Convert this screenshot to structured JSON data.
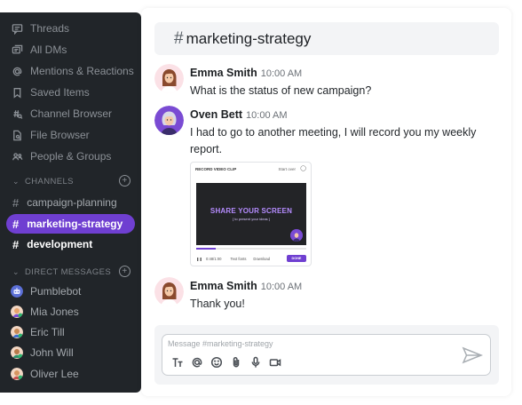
{
  "sidebar": {
    "nav": [
      {
        "label": "Threads",
        "icon": "threads-icon"
      },
      {
        "label": "All DMs",
        "icon": "all-dms-icon"
      },
      {
        "label": "Mentions & Reactions",
        "icon": "at-icon"
      },
      {
        "label": "Saved Items",
        "icon": "bookmark-icon"
      },
      {
        "label": "Channel Browser",
        "icon": "channel-browser-icon"
      },
      {
        "label": "File Browser",
        "icon": "file-browser-icon"
      },
      {
        "label": "People & Groups",
        "icon": "people-icon"
      }
    ],
    "channels_header": "CHANNELS",
    "channels": [
      {
        "name": "campaign-planning",
        "state": "normal"
      },
      {
        "name": "marketing-strategy",
        "state": "active"
      },
      {
        "name": "development",
        "state": "unread"
      }
    ],
    "dms_header": "DIRECT MESSAGES",
    "dms": [
      {
        "name": "Pumblebot",
        "avatar_color": "#5b6fd6"
      },
      {
        "name": "Mia Jones",
        "avatar_color": "#e8a36b"
      },
      {
        "name": "Eric Till",
        "avatar_color": "#e8a36b"
      },
      {
        "name": "John Will",
        "avatar_color": "#e8a36b"
      },
      {
        "name": "Oliver Lee",
        "avatar_color": "#e8a36b"
      }
    ],
    "colors": {
      "bg": "#212529",
      "active": "#6f3fd1",
      "presence": "#2fb36d"
    }
  },
  "channel": {
    "hash": "#",
    "title": "marketing-strategy"
  },
  "messages": [
    {
      "author": "Emma Smith",
      "time": "10:00 AM",
      "text": "What is the status of new campaign?"
    },
    {
      "author": "Oven Bett",
      "time": "10:00 AM",
      "text": "I had to go to another meeting, I will record you my weekly report."
    },
    {
      "author": "Emma Smith",
      "time": "10:00 AM",
      "text": "Thank you!"
    }
  ],
  "clip": {
    "title": "RECORD VIDEO CLIP",
    "start_over": "Start over",
    "headline": "SHARE YOUR SCREEN",
    "subline": "[ to present your ideas ]",
    "time": "0:48/1:00",
    "text_fonts": "Text fonts",
    "download": "Download",
    "done": "DONE",
    "progress": 0.18
  },
  "composer": {
    "placeholder": "Message #marketing-strategy",
    "tools": [
      "text-format-icon",
      "at-icon",
      "emoji-icon",
      "attachment-icon",
      "microphone-icon",
      "video-icon"
    ]
  }
}
